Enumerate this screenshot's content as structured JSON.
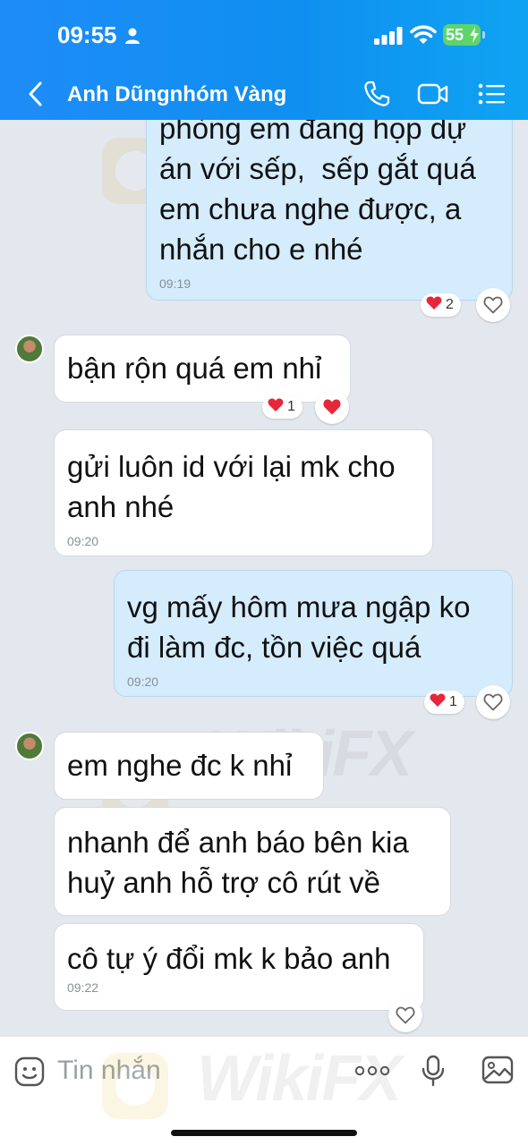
{
  "status": {
    "time": "09:55",
    "battery": "55"
  },
  "header": {
    "title": "Anh Dũngnhóm Vàng"
  },
  "watermark": "WikiFX",
  "messages": [
    {
      "dir": "out",
      "text": "phòng em đang họp dự\nán với sếp,  sếp gắt quá\nem chưa nghe được, a\nnhắn cho e nhé",
      "time": "09:19"
    },
    {
      "dir": "in",
      "text": "bận rộn quá em nhỉ"
    },
    {
      "dir": "in",
      "text": "gửi luôn id với lại mk cho\nanh nhé",
      "time": "09:20"
    },
    {
      "dir": "out",
      "text": "vg mấy hôm mưa ngập ko\nđi làm đc, tồn việc quá",
      "time": "09:20"
    },
    {
      "dir": "in",
      "text": "em nghe đc k nhỉ"
    },
    {
      "dir": "in",
      "text": "nhanh để anh báo bên kia\nhuỷ anh hỗ trợ cô rút về"
    },
    {
      "dir": "in",
      "text": "cô tự ý đổi mk k bảo anh",
      "time": "09:22"
    }
  ],
  "reactions": [
    {
      "emoji": "heart",
      "count": "2"
    },
    {
      "emoji": "heart",
      "count": "1"
    },
    {
      "emoji": "heart",
      "count": "1"
    }
  ],
  "input": {
    "placeholder": "Tin nhắn"
  },
  "colors": {
    "header": "#1e8cf8",
    "outgoing": "#d4ecfc",
    "incoming": "#ffffff",
    "heart": "#e8263a"
  }
}
